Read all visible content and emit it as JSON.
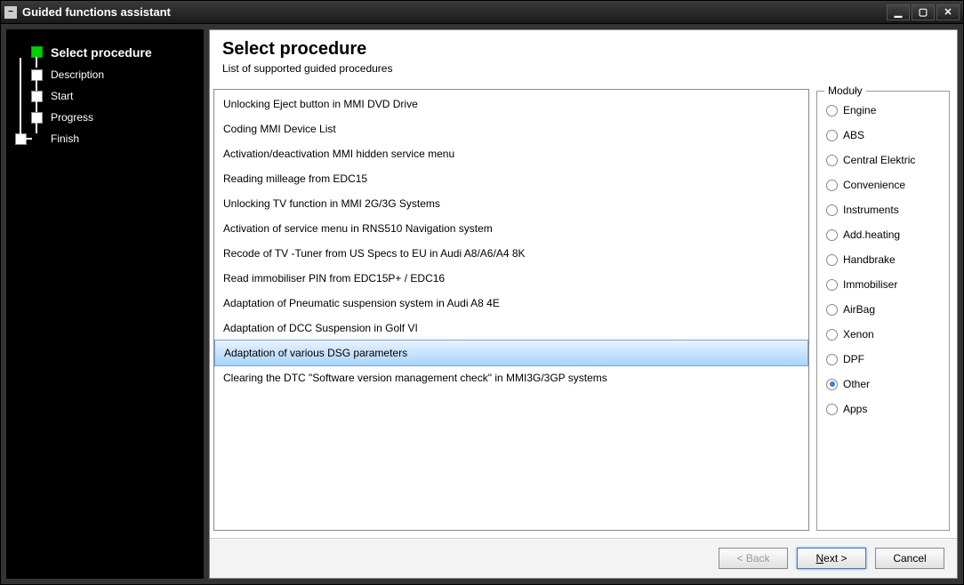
{
  "window": {
    "title": "Guided functions assistant"
  },
  "sidebar": {
    "steps": [
      {
        "label": "Select procedure",
        "active": true
      },
      {
        "label": "Description",
        "active": false
      },
      {
        "label": "Start",
        "active": false
      },
      {
        "label": "Progress",
        "active": false
      },
      {
        "label": "Finish",
        "active": false
      }
    ]
  },
  "header": {
    "title": "Select procedure",
    "subtitle": "List of supported guided procedures"
  },
  "procedures": [
    {
      "label": "Unlocking Eject button in MMI DVD Drive",
      "selected": false
    },
    {
      "label": "Coding MMI Device List",
      "selected": false
    },
    {
      "label": "Activation/deactivation MMI hidden service menu",
      "selected": false
    },
    {
      "label": "Reading milleage from EDC15",
      "selected": false
    },
    {
      "label": "Unlocking TV function in MMI 2G/3G Systems",
      "selected": false
    },
    {
      "label": "Activation of service menu in RNS510 Navigation system",
      "selected": false
    },
    {
      "label": "Recode of TV -Tuner from US Specs to EU in Audi A8/A6/A4 8K",
      "selected": false
    },
    {
      "label": "Read immobiliser PIN from EDC15P+ / EDC16",
      "selected": false
    },
    {
      "label": "Adaptation of Pneumatic suspension system in Audi A8 4E",
      "selected": false
    },
    {
      "label": "Adaptation of DCC Suspension in Golf VI",
      "selected": false
    },
    {
      "label": "Adaptation of various DSG parameters",
      "selected": true
    },
    {
      "label": "Clearing the DTC \"Software version management check\" in MMI3G/3GP systems",
      "selected": false
    }
  ],
  "modules": {
    "legend": "Moduły",
    "items": [
      {
        "label": "Engine",
        "checked": false
      },
      {
        "label": "ABS",
        "checked": false
      },
      {
        "label": "Central Elektric",
        "checked": false
      },
      {
        "label": "Convenience",
        "checked": false
      },
      {
        "label": "Instruments",
        "checked": false
      },
      {
        "label": "Add.heating",
        "checked": false
      },
      {
        "label": "Handbrake",
        "checked": false
      },
      {
        "label": "Immobiliser",
        "checked": false
      },
      {
        "label": "AirBag",
        "checked": false
      },
      {
        "label": "Xenon",
        "checked": false
      },
      {
        "label": "DPF",
        "checked": false
      },
      {
        "label": "Other",
        "checked": true
      },
      {
        "label": "Apps",
        "checked": false
      }
    ]
  },
  "footer": {
    "back_label": "< Back",
    "next_prefix": "N",
    "next_suffix": "ext >",
    "cancel_label": "Cancel"
  }
}
